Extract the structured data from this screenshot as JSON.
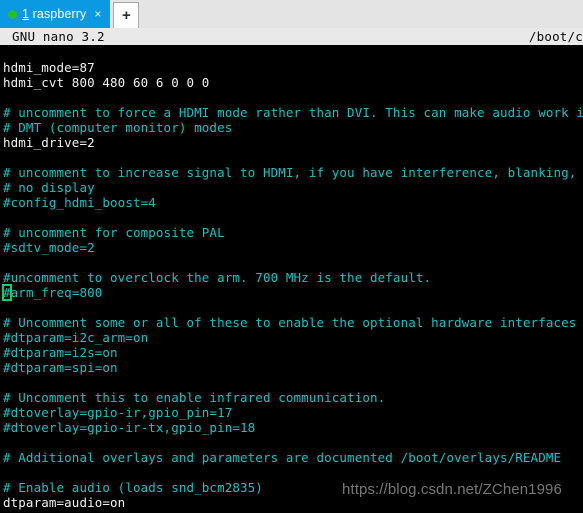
{
  "window": {
    "tabbar": {
      "tabs": [
        {
          "status_dot": "green-status-dot",
          "accesskey": "1",
          "label": " raspberry",
          "close_glyph": "×"
        }
      ],
      "new_tab_glyph": "+"
    }
  },
  "editor": {
    "titlebar": {
      "app_version": "GNU nano 3.2",
      "file_path": "/boot/c"
    },
    "cursor": {
      "line_index": 15,
      "column_char": "#"
    },
    "lines": [
      {
        "text": "hdmi_mode=87",
        "style": "plain"
      },
      {
        "text": "hdmi_cvt 800 480 60 6 0 0 0",
        "style": "plain"
      },
      {
        "text": "",
        "style": "blank"
      },
      {
        "text": "# uncomment to force a HDMI mode rather than DVI. This can make audio work in",
        "style": "comment"
      },
      {
        "text": "# DMT (computer monitor) modes",
        "style": "comment"
      },
      {
        "text": "hdmi_drive=2",
        "style": "plain"
      },
      {
        "text": "",
        "style": "blank"
      },
      {
        "text": "# uncomment to increase signal to HDMI, if you have interference, blanking, or",
        "style": "comment"
      },
      {
        "text": "# no display",
        "style": "comment"
      },
      {
        "text": "#config_hdmi_boost=4",
        "style": "comment"
      },
      {
        "text": "",
        "style": "blank"
      },
      {
        "text": "# uncomment for composite PAL",
        "style": "comment"
      },
      {
        "text": "#sdtv_mode=2",
        "style": "comment"
      },
      {
        "text": "",
        "style": "blank"
      },
      {
        "text": "#uncomment to overclock the arm. 700 MHz is the default.",
        "style": "comment"
      },
      {
        "text": "#arm_freq=800",
        "style": "comment",
        "cursor_at": 0
      },
      {
        "text": "",
        "style": "blank"
      },
      {
        "text": "# Uncomment some or all of these to enable the optional hardware interfaces",
        "style": "comment"
      },
      {
        "text": "#dtparam=i2c_arm=on",
        "style": "comment"
      },
      {
        "text": "#dtparam=i2s=on",
        "style": "comment"
      },
      {
        "text": "#dtparam=spi=on",
        "style": "comment"
      },
      {
        "text": "",
        "style": "blank"
      },
      {
        "text": "# Uncomment this to enable infrared communication.",
        "style": "comment"
      },
      {
        "text": "#dtoverlay=gpio-ir,gpio_pin=17",
        "style": "comment"
      },
      {
        "text": "#dtoverlay=gpio-ir-tx,gpio_pin=18",
        "style": "comment"
      },
      {
        "text": "",
        "style": "blank"
      },
      {
        "text": "# Additional overlays and parameters are documented /boot/overlays/README",
        "style": "comment"
      },
      {
        "text": "",
        "style": "blank"
      },
      {
        "text": "# Enable audio (loads snd_bcm2835)",
        "style": "comment"
      },
      {
        "text": "dtparam=audio=on",
        "style": "plain"
      }
    ]
  },
  "watermark": {
    "text": "https://blog.csdn.net/ZChen1996"
  },
  "colors": {
    "terminal_background": "#000000",
    "comment_text": "#10c4c4",
    "plain_text": "#f2f2f2",
    "cursor_outline": "#19cf5a",
    "tab_active_background": "#0b9ae2",
    "tab_status_dot": "#24c124",
    "tabbar_background": "#e4e4e4",
    "nano_titlebar_background": "#e9e9e9"
  }
}
